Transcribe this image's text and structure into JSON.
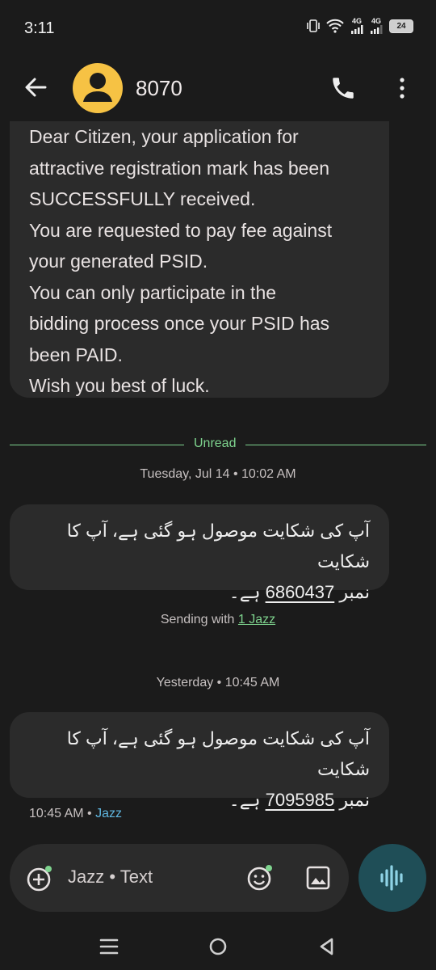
{
  "status": {
    "time": "3:11",
    "net1": "4G",
    "net2": "4G",
    "battery": "24"
  },
  "header": {
    "contact": "8070"
  },
  "messages": [
    {
      "lines": [
        "Dear Citizen, your application for",
        "attractive registration mark has been",
        "SUCCESSFULLY received.",
        "You are requested to pay fee against",
        "your generated PSID.",
        "You can only participate in the",
        "bidding process once your PSID has",
        "been PAID.",
        "Wish you best of luck."
      ]
    },
    {
      "line1": "آپ کی شکایت موصول ہو گئی ہے، آپ کا شکایت",
      "prefix": "نمبر",
      "number": "6860437",
      "suffix": "ہے۔"
    },
    {
      "line1": "آپ کی شکایت موصول ہو گئی ہے، آپ کا شکایت",
      "prefix": "نمبر",
      "number": "7095985",
      "suffix": "ہے۔"
    }
  ],
  "divider": {
    "label": "Unread"
  },
  "timestamps": {
    "first": "Tuesday, Jul 14 • 10:02 AM",
    "second": "Yesterday • 10:45 AM"
  },
  "sending": {
    "prefix": "Sending with",
    "sim": "1 Jazz"
  },
  "last_meta": {
    "time": "10:45 AM",
    "sep": " • ",
    "sim": "Jazz"
  },
  "composer": {
    "placeholder": "Jazz • Text"
  },
  "colors": {
    "accent_green": "#7ed38e",
    "avatar": "#f6c244",
    "sim_blue": "#5fb6e0"
  }
}
